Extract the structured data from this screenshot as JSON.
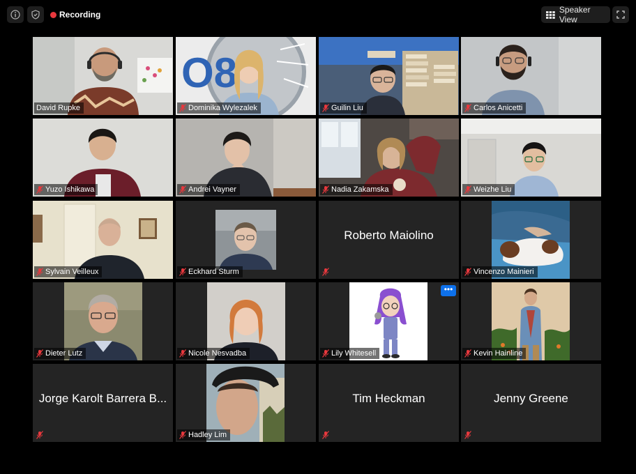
{
  "topbar": {
    "info_icon": "info-icon",
    "shield_icon": "shield-icon",
    "recording_label": "Recording",
    "speaker_view_label": "Speaker View",
    "fullscreen_icon": "fullscreen-icon"
  },
  "participants": [
    {
      "name": "David Rupke",
      "active": true,
      "muted": false
    },
    {
      "name": "Dominika Wylezalek",
      "muted": true
    },
    {
      "name": "Guilin Liu",
      "muted": true
    },
    {
      "name": "Carlos Anicetti",
      "muted": true
    },
    {
      "name": "Yuzo Ishikawa",
      "muted": true
    },
    {
      "name": "Andrei Vayner",
      "muted": true
    },
    {
      "name": "Nadia Zakamska",
      "muted": true
    },
    {
      "name": "Weizhe Liu",
      "muted": true
    },
    {
      "name": "Sylvain Veilleux",
      "muted": true
    },
    {
      "name": "Eckhard Sturm",
      "muted": true
    },
    {
      "name": "Roberto Maiolino",
      "muted": true,
      "video_off": true
    },
    {
      "name": "Vincenzo Mainieri",
      "muted": true
    },
    {
      "name": "Dieter Lutz",
      "muted": true
    },
    {
      "name": "Nicole Nesvadba",
      "muted": true
    },
    {
      "name": "Lily Whitesell",
      "muted": true,
      "more_label": "•••"
    },
    {
      "name": "Kevin Hainline",
      "muted": true
    },
    {
      "name": "Jorge Karolt Barrera B...",
      "muted": true,
      "video_off": true
    },
    {
      "name": "Hadley Lim",
      "muted": true
    },
    {
      "name": "Tim Heckman",
      "muted": true,
      "video_off": true
    },
    {
      "name": "Jenny Greene",
      "muted": true,
      "video_off": true
    }
  ],
  "colors": {
    "background": "#000000",
    "tile": "#242424",
    "active_border": "#d7e47c",
    "recording_dot": "#e8383d",
    "muted_mic": "#e8383d",
    "more_button": "#0e71eb"
  }
}
